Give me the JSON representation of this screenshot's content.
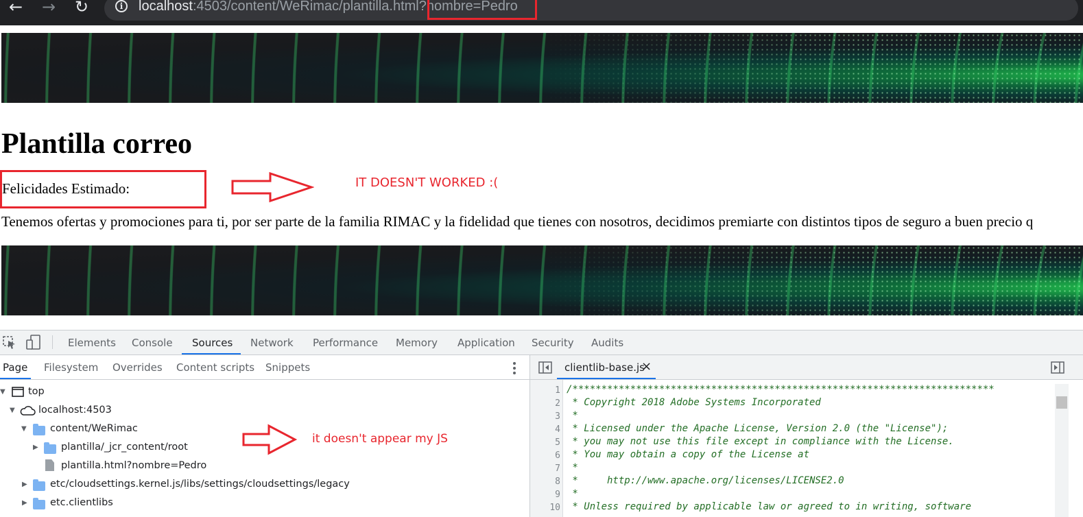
{
  "browser": {
    "back_glyph": "←",
    "forward_glyph": "→",
    "reload_glyph": "↻",
    "url_host": "localhost",
    "url_path": ":4503/content/WeRimac/plantilla.html",
    "url_query": "?nombre=Pedro"
  },
  "page": {
    "title": "Plantilla correo",
    "greeting": "Felicidades Estimado:",
    "body_text": "Tenemos ofertas y promociones para ti, por ser parte de la familia RIMAC y la fidelidad que tienes con nosotros, decidimos premiarte con distintos tipos de seguro a buen precio q"
  },
  "annotations": {
    "top_note": "IT DOESN'T WORKED :(",
    "bottom_note": "it doesn't appear my JS",
    "color": "#e8262e"
  },
  "devtools": {
    "tabs": [
      "Elements",
      "Console",
      "Sources",
      "Network",
      "Performance",
      "Memory",
      "Application",
      "Security",
      "Audits"
    ],
    "active_tab": "Sources",
    "sub_tabs": [
      "Page",
      "Filesystem",
      "Overrides",
      "Content scripts",
      "Snippets"
    ],
    "active_sub_tab": "Page",
    "tree": {
      "top": "top",
      "host": "localhost:4503",
      "folder_content": "content/WeRimac",
      "child_jcr": "plantilla/_jcr_content/root",
      "child_file": "plantilla.html?nombre=Pedro",
      "folder_etc_settings": "etc/cloudsettings.kernel.js/libs/settings/cloudsettings/legacy",
      "folder_etc_clientlibs": "etc.clientlibs"
    },
    "editor": {
      "open_file": "clientlib-base.js",
      "close_glyph": "×",
      "line_numbers": [
        "1",
        "2",
        "3",
        "4",
        "5",
        "6",
        "7",
        "8",
        "9",
        "10"
      ],
      "lines": [
        "/*************************************************************************",
        " * Copyright 2018 Adobe Systems Incorporated",
        " *",
        " * Licensed under the Apache License, Version 2.0 (the \"License\");",
        " * you may not use this file except in compliance with the License.",
        " * You may obtain a copy of the License at",
        " *",
        " *     http://www.apache.org/licenses/LICENSE2.0",
        " *",
        " * Unless required by applicable law or agreed to in writing, software"
      ]
    }
  }
}
